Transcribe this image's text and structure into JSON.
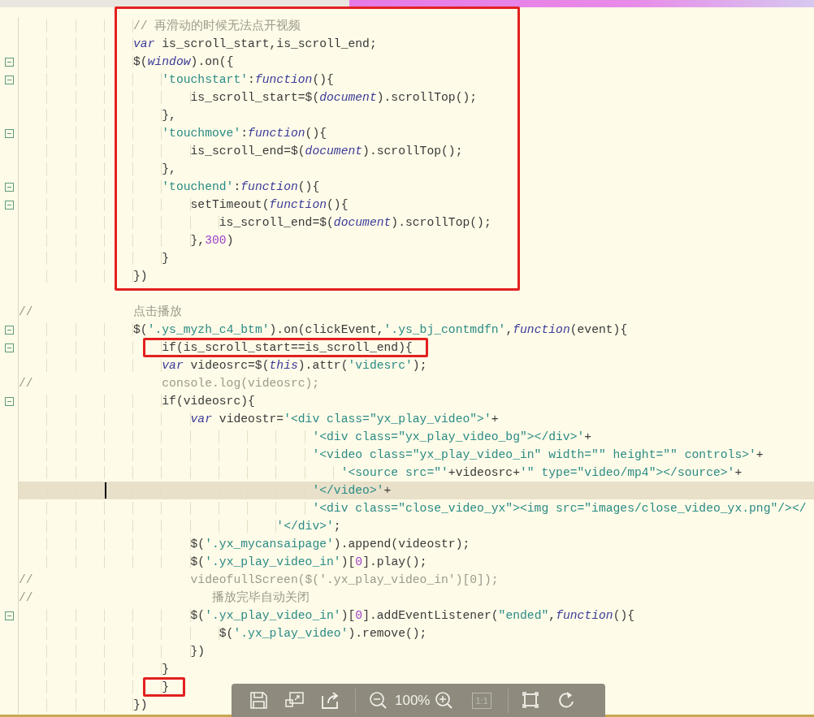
{
  "editor": {
    "blocks": [
      {
        "boxed": true,
        "lines": [
          {
            "fold": false,
            "current": false,
            "segments": [
              {
                "kind": "comment",
                "text": "                // 再滑动的时候无法点开视频"
              }
            ]
          },
          {
            "fold": false,
            "current": false,
            "segments": [
              {
                "kind": "keyword",
                "text": "                var"
              },
              {
                "kind": "plain",
                "text": " is_scroll_start,is_scroll_end;"
              }
            ]
          },
          {
            "fold": true,
            "current": false,
            "segments": [
              {
                "kind": "plain",
                "text": "                $("
              },
              {
                "kind": "keyword",
                "text": "window"
              },
              {
                "kind": "plain",
                "text": ").on({"
              }
            ]
          },
          {
            "fold": true,
            "current": false,
            "segments": [
              {
                "kind": "string",
                "text": "                    'touchstart'"
              },
              {
                "kind": "plain",
                "text": ":"
              },
              {
                "kind": "keyword",
                "text": "function"
              },
              {
                "kind": "plain",
                "text": "(){"
              }
            ]
          },
          {
            "fold": false,
            "current": false,
            "segments": [
              {
                "kind": "plain",
                "text": "                        is_scroll_start=$("
              },
              {
                "kind": "keyword",
                "text": "document"
              },
              {
                "kind": "plain",
                "text": ").scrollTop();"
              }
            ]
          },
          {
            "fold": false,
            "current": false,
            "segments": [
              {
                "kind": "plain",
                "text": "                    },"
              }
            ]
          },
          {
            "fold": true,
            "current": false,
            "segments": [
              {
                "kind": "string",
                "text": "                    'touchmove'"
              },
              {
                "kind": "plain",
                "text": ":"
              },
              {
                "kind": "keyword",
                "text": "function"
              },
              {
                "kind": "plain",
                "text": "(){"
              }
            ]
          },
          {
            "fold": false,
            "current": false,
            "segments": [
              {
                "kind": "plain",
                "text": "                        is_scroll_end=$("
              },
              {
                "kind": "keyword",
                "text": "document"
              },
              {
                "kind": "plain",
                "text": ").scrollTop();"
              }
            ]
          },
          {
            "fold": false,
            "current": false,
            "segments": [
              {
                "kind": "plain",
                "text": "                    },"
              }
            ]
          },
          {
            "fold": true,
            "current": false,
            "segments": [
              {
                "kind": "string",
                "text": "                    'touchend'"
              },
              {
                "kind": "plain",
                "text": ":"
              },
              {
                "kind": "keyword",
                "text": "function"
              },
              {
                "kind": "plain",
                "text": "(){"
              }
            ]
          },
          {
            "fold": true,
            "current": false,
            "segments": [
              {
                "kind": "plain",
                "text": "                        setTimeout("
              },
              {
                "kind": "keyword",
                "text": "function"
              },
              {
                "kind": "plain",
                "text": "(){"
              }
            ]
          },
          {
            "fold": false,
            "current": false,
            "segments": [
              {
                "kind": "plain",
                "text": "                            is_scroll_end=$("
              },
              {
                "kind": "keyword",
                "text": "document"
              },
              {
                "kind": "plain",
                "text": ").scrollTop();"
              }
            ]
          },
          {
            "fold": false,
            "current": false,
            "segments": [
              {
                "kind": "plain",
                "text": "                        },"
              },
              {
                "kind": "number",
                "text": "300"
              },
              {
                "kind": "plain",
                "text": ")"
              }
            ]
          },
          {
            "fold": false,
            "current": false,
            "segments": [
              {
                "kind": "plain",
                "text": "                    }"
              }
            ]
          },
          {
            "fold": false,
            "current": false,
            "segments": [
              {
                "kind": "plain",
                "text": "                })"
              }
            ]
          }
        ]
      },
      {
        "boxed": false,
        "lines": [
          {
            "fold": false,
            "current": false
          },
          {
            "fold": false,
            "current": false,
            "segments": [
              {
                "kind": "comment",
                "text": "//              点击播放"
              }
            ]
          },
          {
            "fold": true,
            "current": false,
            "segments": [
              {
                "kind": "plain",
                "text": "                $("
              },
              {
                "kind": "string",
                "text": "'.ys_myzh_c4_btm'"
              },
              {
                "kind": "plain",
                "text": ").on(clickEvent,"
              },
              {
                "kind": "string",
                "text": "'.ys_bj_contmdfn'"
              },
              {
                "kind": "plain",
                "text": ","
              },
              {
                "kind": "keyword",
                "text": "function"
              },
              {
                "kind": "plain",
                "text": "(event){"
              }
            ]
          }
        ]
      },
      {
        "boxed": true,
        "lines": [
          {
            "fold": true,
            "current": false,
            "segments": [
              {
                "kind": "plain",
                "text": "                    if(is_scroll_start==is_scroll_end){"
              }
            ]
          }
        ]
      },
      {
        "boxed": false,
        "lines": [
          {
            "fold": false,
            "current": false,
            "segments": [
              {
                "kind": "keyword",
                "text": "                    var"
              },
              {
                "kind": "plain",
                "text": " videosrc=$("
              },
              {
                "kind": "keyword",
                "text": "this"
              },
              {
                "kind": "plain",
                "text": ").attr("
              },
              {
                "kind": "string",
                "text": "'videsrc'"
              },
              {
                "kind": "plain",
                "text": ");"
              }
            ]
          },
          {
            "fold": false,
            "current": false,
            "segments": [
              {
                "kind": "comment",
                "text": "//                  console.log(videosrc);"
              }
            ]
          },
          {
            "fold": true,
            "current": false,
            "segments": [
              {
                "kind": "plain",
                "text": "                    if(videosrc){"
              }
            ]
          },
          {
            "fold": false,
            "current": false,
            "segments": [
              {
                "kind": "keyword",
                "text": "                        var"
              },
              {
                "kind": "plain",
                "text": " videostr="
              },
              {
                "kind": "string",
                "text": "'<div class=\"yx_play_video\">'"
              },
              {
                "kind": "plain",
                "text": "+"
              }
            ]
          },
          {
            "fold": false,
            "current": false,
            "segments": [
              {
                "kind": "string",
                "text": "                                         '<div class=\"yx_play_video_bg\"></div>'"
              },
              {
                "kind": "plain",
                "text": "+"
              }
            ]
          },
          {
            "fold": false,
            "current": false,
            "segments": [
              {
                "kind": "string",
                "text": "                                         '<video class=\"yx_play_video_in\" width=\"\" height=\"\" controls>'"
              },
              {
                "kind": "plain",
                "text": "+"
              }
            ]
          },
          {
            "fold": false,
            "current": false,
            "segments": [
              {
                "kind": "string",
                "text": "                                             '<source src=\"'"
              },
              {
                "kind": "plain",
                "text": "+videosrc+"
              },
              {
                "kind": "string",
                "text": "'\" type=\"video/mp4\"></source>'"
              },
              {
                "kind": "plain",
                "text": "+"
              }
            ]
          },
          {
            "fold": false,
            "current": true,
            "segments": [
              {
                "kind": "string",
                "text": "                                         '</video>'"
              },
              {
                "kind": "plain",
                "text": "+"
              }
            ]
          },
          {
            "fold": false,
            "current": false,
            "segments": [
              {
                "kind": "string",
                "text": "                                         '<div class=\"close_video_yx\"><img src=\"images/close_video_yx.png\"/></"
              }
            ]
          },
          {
            "fold": false,
            "current": false,
            "segments": [
              {
                "kind": "string",
                "text": "                                    '</div>'"
              },
              {
                "kind": "plain",
                "text": ";"
              }
            ]
          },
          {
            "fold": false,
            "current": false,
            "segments": [
              {
                "kind": "plain",
                "text": "                        $("
              },
              {
                "kind": "string",
                "text": "'.yx_mycansaipage'"
              },
              {
                "kind": "plain",
                "text": ").append(videostr);"
              }
            ]
          },
          {
            "fold": false,
            "current": false,
            "segments": [
              {
                "kind": "plain",
                "text": "                        $("
              },
              {
                "kind": "string",
                "text": "'.yx_play_video_in'"
              },
              {
                "kind": "plain",
                "text": ")["
              },
              {
                "kind": "number",
                "text": "0"
              },
              {
                "kind": "plain",
                "text": "].play();"
              }
            ]
          },
          {
            "fold": false,
            "current": false,
            "segments": [
              {
                "kind": "comment",
                "text": "//                      videofullScreen($('.yx_play_video_in')[0]);"
              }
            ]
          },
          {
            "fold": false,
            "current": false,
            "segments": [
              {
                "kind": "comment",
                "text": "//                         播放完毕自动关闭"
              }
            ]
          },
          {
            "fold": true,
            "current": false,
            "segments": [
              {
                "kind": "plain",
                "text": "                        $("
              },
              {
                "kind": "string",
                "text": "'.yx_play_video_in'"
              },
              {
                "kind": "plain",
                "text": ")["
              },
              {
                "kind": "number",
                "text": "0"
              },
              {
                "kind": "plain",
                "text": "].addEventListener("
              },
              {
                "kind": "string",
                "text": "\"ended\""
              },
              {
                "kind": "plain",
                "text": ","
              },
              {
                "kind": "keyword",
                "text": "function"
              },
              {
                "kind": "plain",
                "text": "(){"
              }
            ]
          },
          {
            "fold": false,
            "current": false,
            "segments": [
              {
                "kind": "plain",
                "text": "                            $("
              },
              {
                "kind": "string",
                "text": "'.yx_play_video'"
              },
              {
                "kind": "plain",
                "text": ").remove();"
              }
            ]
          },
          {
            "fold": false,
            "current": false,
            "segments": [
              {
                "kind": "plain",
                "text": "                        })"
              }
            ]
          },
          {
            "fold": false,
            "current": false,
            "segments": [
              {
                "kind": "plain",
                "text": "                    }"
              }
            ]
          }
        ]
      },
      {
        "boxed": true,
        "lines": [
          {
            "fold": false,
            "current": false,
            "segments": [
              {
                "kind": "plain",
                "text": "                    }"
              }
            ]
          }
        ]
      },
      {
        "boxed": false,
        "lines": [
          {
            "fold": false,
            "current": false,
            "segments": [
              {
                "kind": "plain",
                "text": "                })"
              }
            ]
          }
        ]
      }
    ]
  },
  "toolbar": [
    {
      "kind": "save"
    },
    {
      "kind": "window"
    },
    {
      "kind": "share"
    },
    {
      "kind": "divider"
    },
    {
      "kind": "zoom_out"
    },
    {
      "kind": "zoom_level",
      "text": "100%"
    },
    {
      "kind": "zoom_in"
    },
    {
      "kind": "actual_size",
      "text": "1:1",
      "disabled": true
    },
    {
      "kind": "divider"
    },
    {
      "kind": "fullscreen"
    },
    {
      "kind": "rotate"
    }
  ]
}
